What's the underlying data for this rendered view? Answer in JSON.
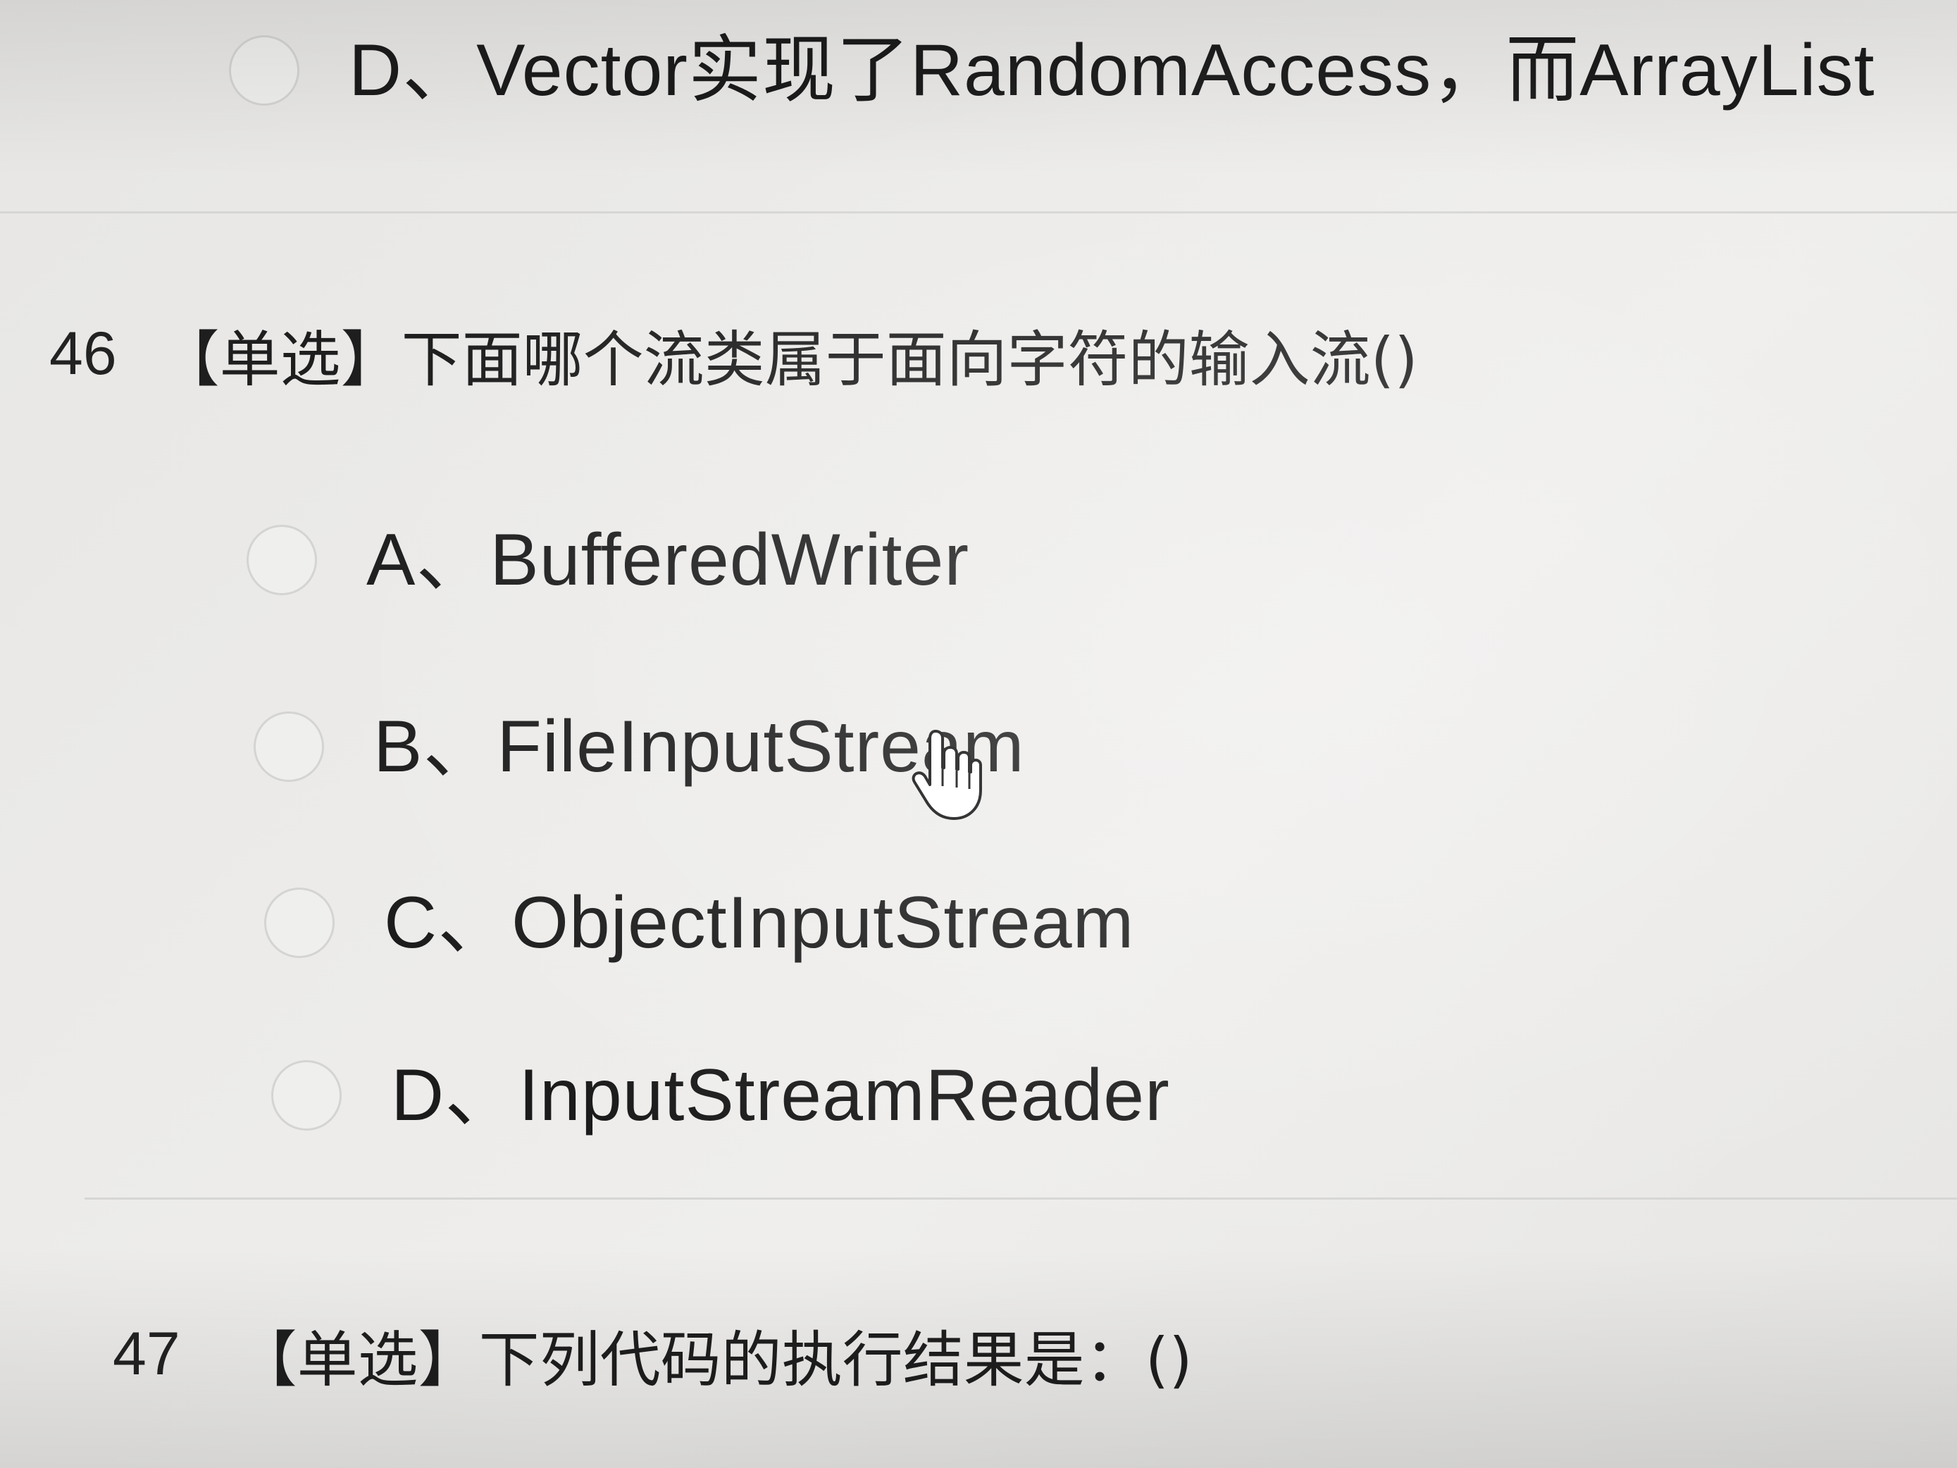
{
  "prev_question": {
    "option_d": "D、Vector实现了RandomAccess，而ArrayList"
  },
  "question_46": {
    "number": "46",
    "text": "【单选】下面哪个流类属于面向字符的输入流()",
    "options": [
      {
        "label": "A、BufferedWriter"
      },
      {
        "label": "B、FileInputStream"
      },
      {
        "label": "C、ObjectInputStream"
      },
      {
        "label": "D、InputStreamReader"
      }
    ]
  },
  "question_47": {
    "number": "47",
    "text": "【单选】下列代码的执行结果是：()"
  },
  "icons": {
    "cursor": "hand-pointer-icon",
    "radio": "radio-unchecked-icon"
  }
}
